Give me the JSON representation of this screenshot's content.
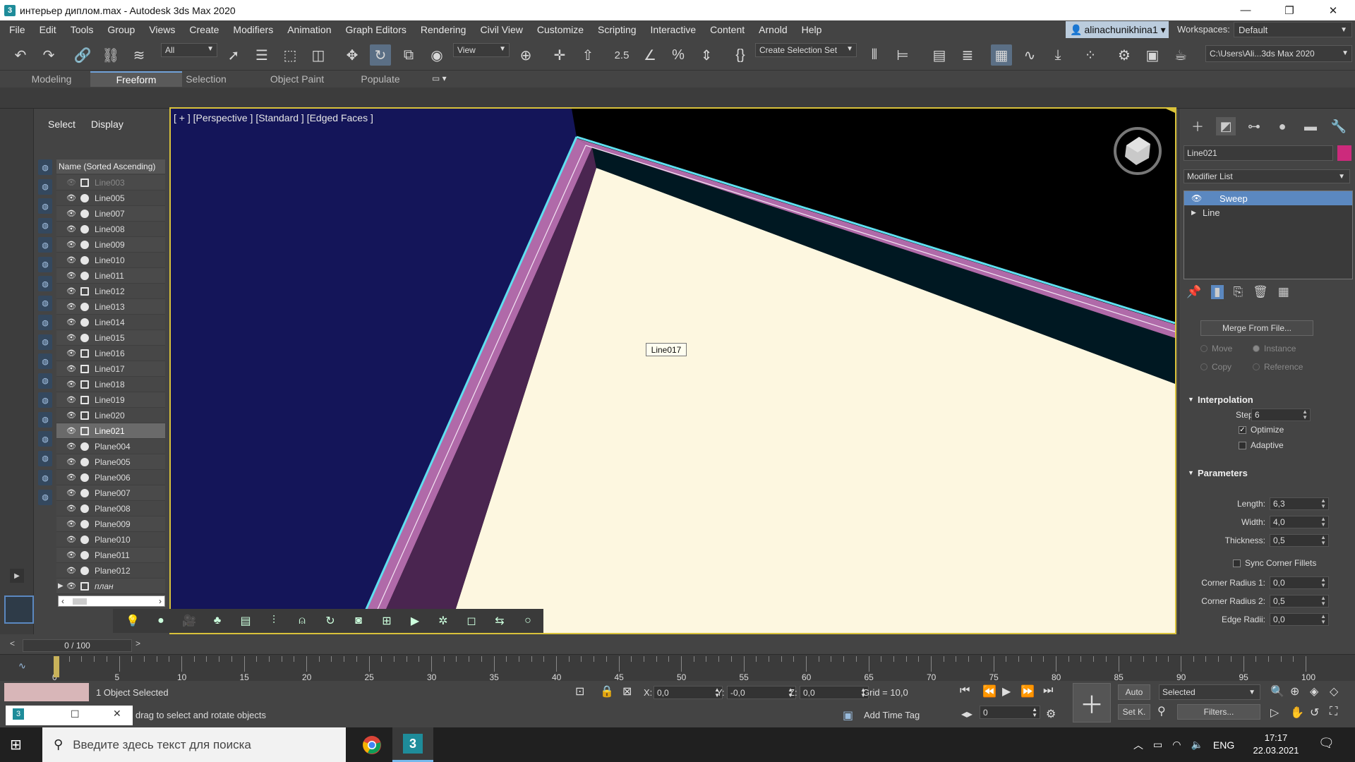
{
  "window": {
    "title": "интерьер диплом.max - Autodesk 3ds Max 2020",
    "min": "—",
    "max": "❐",
    "close": "✕"
  },
  "menu": {
    "items": [
      "File",
      "Edit",
      "Tools",
      "Group",
      "Views",
      "Create",
      "Modifiers",
      "Animation",
      "Graph Editors",
      "Rendering",
      "Civil View",
      "Customize",
      "Scripting",
      "Interactive",
      "Content",
      "Arnold",
      "Help"
    ],
    "user": "alinachunikhina1 ▾",
    "workspaces_label": "Workspaces:",
    "workspace": "Default"
  },
  "toolbar": {
    "filter": "All",
    "refcoord": "View",
    "selection_set": "Create Selection Set",
    "project_path": "C:\\Users\\Ali...3ds Max 2020"
  },
  "ribbon": {
    "tabs": [
      "Modeling",
      "Freeform",
      "Selection",
      "Object Paint",
      "Populate"
    ],
    "active": "Freeform"
  },
  "explorer": {
    "tab_select": "Select",
    "tab_display": "Display",
    "column_header": "Name (Sorted Ascending)",
    "rows": [
      {
        "name": "Line003",
        "kind": "shape",
        "state": "dim"
      },
      {
        "name": "Line005",
        "kind": "geo",
        "state": ""
      },
      {
        "name": "Line007",
        "kind": "geo",
        "state": ""
      },
      {
        "name": "Line008",
        "kind": "geo",
        "state": ""
      },
      {
        "name": "Line009",
        "kind": "geo",
        "state": ""
      },
      {
        "name": "Line010",
        "kind": "geo",
        "state": ""
      },
      {
        "name": "Line011",
        "kind": "geo",
        "state": ""
      },
      {
        "name": "Line012",
        "kind": "shape",
        "state": ""
      },
      {
        "name": "Line013",
        "kind": "geo",
        "state": ""
      },
      {
        "name": "Line014",
        "kind": "geo",
        "state": ""
      },
      {
        "name": "Line015",
        "kind": "geo",
        "state": ""
      },
      {
        "name": "Line016",
        "kind": "shape",
        "state": ""
      },
      {
        "name": "Line017",
        "kind": "shape",
        "state": ""
      },
      {
        "name": "Line018",
        "kind": "shape",
        "state": ""
      },
      {
        "name": "Line019",
        "kind": "shape",
        "state": ""
      },
      {
        "name": "Line020",
        "kind": "shape",
        "state": ""
      },
      {
        "name": "Line021",
        "kind": "shape",
        "state": "sel"
      },
      {
        "name": "Plane004",
        "kind": "geo",
        "state": ""
      },
      {
        "name": "Plane005",
        "kind": "geo",
        "state": ""
      },
      {
        "name": "Plane006",
        "kind": "geo",
        "state": ""
      },
      {
        "name": "Plane007",
        "kind": "geo",
        "state": ""
      },
      {
        "name": "Plane008",
        "kind": "geo",
        "state": ""
      },
      {
        "name": "Plane009",
        "kind": "geo",
        "state": ""
      },
      {
        "name": "Plane010",
        "kind": "geo",
        "state": ""
      },
      {
        "name": "Plane011",
        "kind": "geo",
        "state": ""
      },
      {
        "name": "Plane012",
        "kind": "geo",
        "state": ""
      },
      {
        "name": "план",
        "kind": "shape",
        "state": "group"
      }
    ]
  },
  "viewport": {
    "label": "[ + ] [Perspective ] [Standard ] [Edged Faces ]",
    "tooltip": "Line017",
    "colors": {
      "wall": "#141559",
      "ceiling": "#fdf7e0",
      "molding": "#b06aa9",
      "highlight": "#5fe0f0",
      "shadow": "#4a2550",
      "dark": "#001822"
    }
  },
  "command_panel": {
    "object_name": "Line021",
    "object_color": "#cc2a7c",
    "modifier_list": "Modifier List",
    "stack": [
      "Sweep",
      "Line"
    ],
    "merge_btn": "Merge From File...",
    "radio_move": "Move",
    "radio_instance": "Instance",
    "radio_copy": "Copy",
    "radio_reference": "Reference",
    "interpolation": "Interpolation",
    "steps_label": "Steps:",
    "steps": "6",
    "optimize": "Optimize",
    "adaptive": "Adaptive",
    "parameters": "Parameters",
    "length_label": "Length:",
    "length": "6,3",
    "width_label": "Width:",
    "width": "4,0",
    "thickness_label": "Thickness:",
    "thickness": "0,5",
    "sync": "Sync Corner Fillets",
    "cr1_label": "Corner Radius 1:",
    "cr1": "0,0",
    "cr2_label": "Corner Radius 2:",
    "cr2": "0,5",
    "edge_label": "Edge Radii:",
    "edge": "0,0"
  },
  "timeline": {
    "frame": "0 / 100",
    "ticks": [
      "0",
      "5",
      "10",
      "15",
      "20",
      "25",
      "30",
      "35",
      "40",
      "45",
      "50",
      "55",
      "60",
      "65",
      "70",
      "75",
      "80",
      "85",
      "90",
      "95",
      "100"
    ]
  },
  "status": {
    "selected": "1 Object Selected",
    "prompt": "drag to select and rotate objects",
    "x_label": "X:",
    "x": "0,0",
    "y_label": "Y:",
    "y": "-0,0",
    "z_label": "Z:",
    "z": "0,0",
    "grid": "Grid = 10,0",
    "add_time_tag": "Add Time Tag",
    "auto": "Auto",
    "selected_drop": "Selected",
    "setk": "Set K.",
    "filters": "Filters...",
    "frame_field": "0"
  },
  "taskbar": {
    "search_placeholder": "Введите здесь текст для поиска",
    "lang": "ENG",
    "time": "17:17",
    "date": "22.03.2021"
  }
}
